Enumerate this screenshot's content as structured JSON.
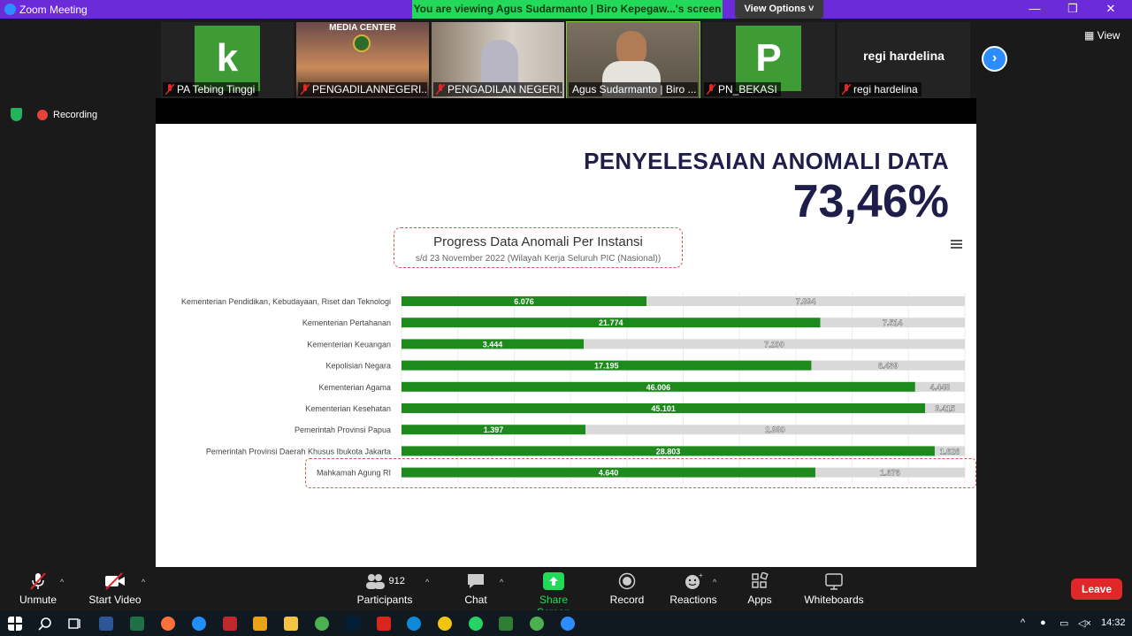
{
  "window": {
    "title": "Zoom Meeting",
    "viewing_banner": "You are viewing Agus Sudarmanto | Biro Kepegaw...'s screen",
    "view_options": "View Options ˅"
  },
  "gallery": {
    "view_label": "View",
    "participants": [
      {
        "name": "PA Tebing Tinggi",
        "tile_letter": "k",
        "tile_color": "#3f9b36"
      },
      {
        "name": "PENGADILANNEGERI...",
        "tile_letter": "",
        "tile_color": "#5b3a3a"
      },
      {
        "name": "PENGADILAN NEGERI...",
        "tile_letter": "",
        "tile_color": "#9a8a7a"
      },
      {
        "name": "Agus Sudarmanto | Biro ...",
        "tile_letter": "",
        "tile_color": "#6b6256"
      },
      {
        "name": "PN_BEKASI",
        "tile_letter": "P",
        "tile_color": "#3f9b36"
      },
      {
        "name": "regi hardelina",
        "tile_letter": "",
        "big_name": "regi hardelina",
        "tile_color": "#232323"
      }
    ],
    "media_center_label": "MEDIA CENTER"
  },
  "status": {
    "recording_label": "Recording"
  },
  "slide": {
    "title": "PENYELESAIAN ANOMALI DATA",
    "percent": "73,46%",
    "chart_title": "Progress Data Anomali Per Instansi",
    "chart_subtitle": "s/d 23 November 2022 (Wilayah Kerja Seluruh PIC (Nasional))"
  },
  "chart_data": {
    "type": "bar",
    "orientation": "horizontal",
    "stacked": true,
    "categories": [
      "Kementerian Pendidikan, Kebudayaan, Riset dan Teknologi",
      "Kementerian Pertahanan",
      "Kementerian Keuangan",
      "Kepolisian Negara",
      "Kementerian Agama",
      "Kementerian Kesehatan",
      "Pemerintah Provinsi Papua",
      "Pemerintah Provinsi Daerah Khusus Ibukota Jakarta",
      "Mahkamah Agung RI"
    ],
    "series": [
      {
        "color": "#1e8a1e",
        "values": [
          6076,
          21774,
          3444,
          17195,
          46006,
          45101,
          1397,
          28803,
          4640
        ],
        "labels": [
          "6.076",
          "21.774",
          "3.444",
          "17.195",
          "46.006",
          "45.101",
          "1.397",
          "28.803",
          "4.640"
        ]
      },
      {
        "color": "#d9d9d9",
        "values": [
          7894,
          7514,
          7200,
          6439,
          4448,
          3415,
          2880,
          1626,
          1676
        ],
        "labels": [
          "7.894",
          "7.514",
          "7.200",
          "6.439",
          "4.448",
          "3.415",
          "2.880",
          "1.626",
          "1.676"
        ]
      }
    ],
    "normalized": true,
    "xlim": [
      0,
      1
    ],
    "grid": true
  },
  "toolbar": {
    "unmute": "Unmute",
    "start_video": "Start Video",
    "participants": "Participants",
    "participant_count": "912",
    "chat": "Chat",
    "share_screen": "Share Screen",
    "record": "Record",
    "reactions": "Reactions",
    "apps": "Apps",
    "whiteboards": "Whiteboards",
    "leave": "Leave"
  },
  "taskbar": {
    "clock": "14:32"
  }
}
